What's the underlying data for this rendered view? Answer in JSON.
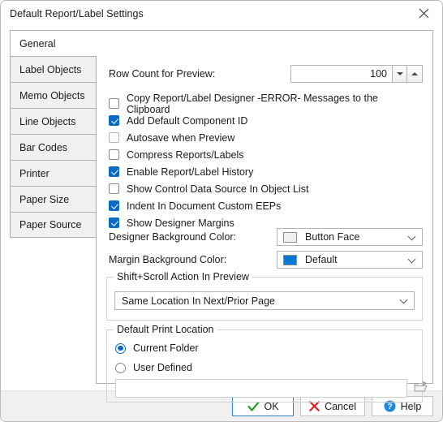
{
  "window": {
    "title": "Default Report/Label Settings",
    "close_icon": "close-icon"
  },
  "tabs": [
    {
      "label": "General",
      "selected": true
    },
    {
      "label": "Label Objects",
      "selected": false
    },
    {
      "label": "Memo Objects",
      "selected": false
    },
    {
      "label": "Line Objects",
      "selected": false
    },
    {
      "label": "Bar Codes",
      "selected": false
    },
    {
      "label": "Printer",
      "selected": false
    },
    {
      "label": "Paper Size",
      "selected": false
    },
    {
      "label": "Paper Source",
      "selected": false
    }
  ],
  "general": {
    "row_count": {
      "label": "Row Count for Preview:",
      "value": "100",
      "spin_down_icon": "chevron-down-icon",
      "spin_up_icon": "chevron-up-icon"
    },
    "checkboxes": [
      {
        "label": "Copy Report/Label Designer -ERROR- Messages to the Clipboard",
        "checked": false
      },
      {
        "label": "Add Default Component ID",
        "checked": true
      },
      {
        "label": "Autosave when Preview",
        "checked": false
      },
      {
        "label": "Compress Reports/Labels",
        "checked": false
      },
      {
        "label": "Enable Report/Label History",
        "checked": true
      },
      {
        "label": "Show Control Data Source In Object List",
        "checked": false
      },
      {
        "label": "Indent In Document Custom EEPs",
        "checked": true
      },
      {
        "label": "Show Designer Margins",
        "checked": true
      }
    ],
    "designer_bg": {
      "label": "Designer Background Color:",
      "value": "Button Face",
      "swatch": "#f0f0f0",
      "chevron_icon": "chevron-down-icon"
    },
    "margin_bg": {
      "label": "Margin Background Color:",
      "value": "Default",
      "swatch": "#0a78d4",
      "chevron_icon": "chevron-down-icon"
    },
    "shift_scroll": {
      "title": "Shift+Scroll Action In Preview",
      "value": "Same Location In Next/Prior Page",
      "chevron_icon": "chevron-down-icon"
    },
    "print_location": {
      "title": "Default Print Location",
      "options": [
        {
          "label": "Current Folder",
          "selected": true
        },
        {
          "label": "User Defined",
          "selected": false
        }
      ],
      "path_value": "",
      "browse_icon": "open-folder-icon"
    }
  },
  "footer": {
    "ok": {
      "label": "OK",
      "icon": "check-icon"
    },
    "cancel": {
      "label": "Cancel",
      "icon": "x-icon"
    },
    "help": {
      "label": "Help",
      "icon": "question-circle-icon"
    }
  }
}
